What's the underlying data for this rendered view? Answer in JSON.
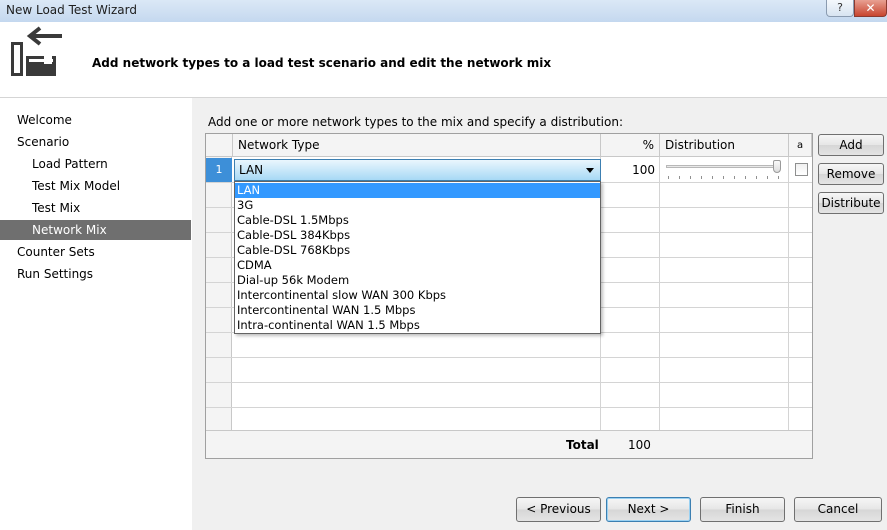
{
  "window": {
    "title": "New Load Test Wizard",
    "help_label": "?",
    "close_label": "✕"
  },
  "header": {
    "title": "Add network types to a load test scenario and edit the network mix"
  },
  "nav": {
    "items": [
      {
        "label": "Welcome",
        "level": 0,
        "selected": false
      },
      {
        "label": "Scenario",
        "level": 0,
        "selected": false
      },
      {
        "label": "Load Pattern",
        "level": 1,
        "selected": false
      },
      {
        "label": "Test Mix Model",
        "level": 1,
        "selected": false
      },
      {
        "label": "Test Mix",
        "level": 1,
        "selected": false
      },
      {
        "label": "Network Mix",
        "level": 1,
        "selected": true
      },
      {
        "label": "Counter Sets",
        "level": 0,
        "selected": false
      },
      {
        "label": "Run Settings",
        "level": 0,
        "selected": false
      }
    ]
  },
  "content": {
    "instruction": "Add one or more network types to the mix and specify a distribution:",
    "grid": {
      "columns": {
        "network_type": "Network Type",
        "percent": "%",
        "distribution": "Distribution",
        "lock": "a"
      },
      "rows": [
        {
          "number": "1",
          "network_type": "LAN",
          "percent": "100",
          "distribution_fraction": 1.0,
          "locked": false
        }
      ],
      "total_label": "Total",
      "total_value": "100"
    },
    "dropdown": {
      "selected": "LAN",
      "options": [
        "LAN",
        "3G",
        "Cable-DSL 1.5Mbps",
        "Cable-DSL 384Kbps",
        "Cable-DSL 768Kbps",
        "CDMA",
        "Dial-up 56k Modem",
        "Intercontinental slow WAN 300 Kbps",
        "Intercontinental WAN 1.5 Mbps",
        "Intra-continental WAN 1.5 Mbps"
      ]
    },
    "side_buttons": {
      "add": "Add",
      "remove": "Remove",
      "distribute": "Distribute"
    }
  },
  "footer": {
    "previous": "< Previous",
    "next": "Next >",
    "finish": "Finish",
    "cancel": "Cancel"
  }
}
